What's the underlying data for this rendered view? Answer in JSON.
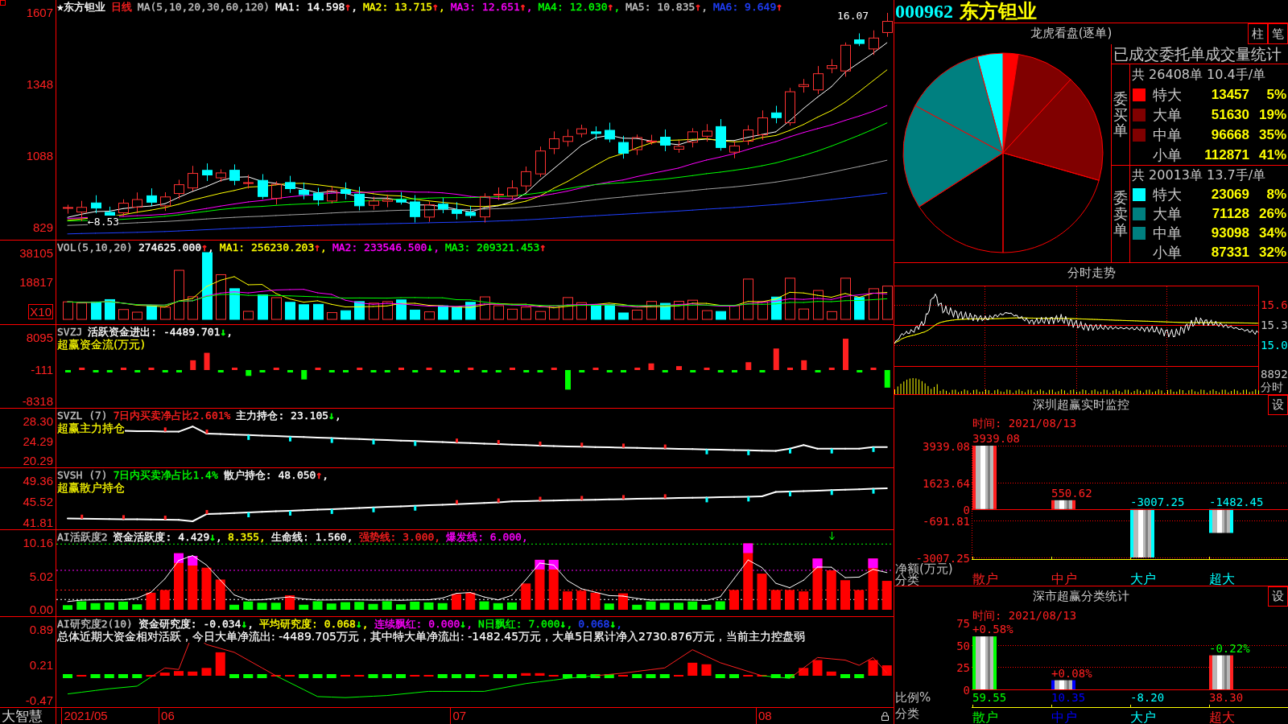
{
  "main_chart": {
    "legend": [
      {
        "text": "★东方钽业",
        "color": "#ffffff"
      },
      {
        "text": "日线",
        "color": "#ff2020"
      },
      {
        "text": "MA(5,10,20,30,60,120)"
      },
      {
        "text": "MA1: 14.598",
        "color": "#ffffff",
        "arrow": {
          "text": "↑",
          "color": "#ff2020"
        },
        "end": ","
      },
      {
        "text": "MA2: 13.715",
        "color": "#ffff00",
        "arrow": {
          "text": "↑",
          "color": "#ff2020"
        },
        "end": ","
      },
      {
        "text": "MA3: 12.651",
        "color": "#ff00ff",
        "arrow": {
          "text": "↑",
          "color": "#ff2020"
        },
        "end": ","
      },
      {
        "text": "MA4: 12.030",
        "color": "#00ff00",
        "arrow": {
          "text": "↑",
          "color": "#ff2020"
        },
        "end": ","
      },
      {
        "text": "MA5: 10.835",
        "color": "#c0c0c0",
        "arrow": {
          "text": "↑",
          "color": "#ff2020"
        },
        "end": ","
      },
      {
        "text": "MA6: 9.649",
        "color": "#2040ff",
        "arrow": {
          "text": "↑",
          "color": "#ff2020"
        }
      }
    ],
    "y_ticks": [
      "1607",
      "1348",
      "1088",
      "829"
    ],
    "high_label": "16.07",
    "low_label": "←8.53"
  },
  "panels": [
    {
      "kind": "volume",
      "legend": [
        {
          "text": "VOL(5,10,20)"
        },
        {
          "text": "274625.000",
          "color": "#ffffff",
          "arrow": {
            "text": "↑",
            "color": "#ff2020"
          },
          "end": ","
        },
        {
          "text": "MA1: 256230.203",
          "color": "#ffff00",
          "arrow": {
            "text": "↑",
            "color": "#ff2020"
          },
          "end": ","
        },
        {
          "text": "MA2: 233546.500",
          "color": "#ff00ff",
          "arrow": {
            "text": "↓",
            "color": "#00ff00"
          },
          "end": ","
        },
        {
          "text": "MA3: 209321.453",
          "color": "#00ff00",
          "arrow": {
            "text": "↑",
            "color": "#ff2020"
          }
        }
      ],
      "y_ticks": [
        "38105",
        "18817"
      ],
      "unit": "X10"
    },
    {
      "kind": "flow",
      "legend": [
        {
          "text": "SVZJ"
        },
        {
          "text": "活跃资金进出: -4489.701",
          "color": "#ffffff",
          "arrow": {
            "text": "↓",
            "color": "#00ff00"
          },
          "end": ","
        }
      ],
      "subtitle": {
        "text": "超赢资金流(万元)",
        "color": "#ffff00"
      },
      "y_ticks": [
        "8095",
        "-111",
        "-8318"
      ]
    },
    {
      "kind": "decline",
      "legend": [
        {
          "text": "SVZL (7)"
        },
        {
          "text": "7日内买卖净占比2.601%",
          "color": "#ff2020"
        },
        {
          "text": "主力持仓: 23.105",
          "color": "#ffffff",
          "arrow": {
            "text": "↓",
            "color": "#00ff00"
          },
          "end": ","
        }
      ],
      "subtitle": {
        "text": "超赢主力持仓",
        "color": "#ffff00"
      },
      "y_ticks": [
        "28.30",
        "24.29",
        "20.29"
      ]
    },
    {
      "kind": "rise",
      "legend": [
        {
          "text": "SVSH (7)"
        },
        {
          "text": "7日内买卖净占比1.4%",
          "color": "#00ff00"
        },
        {
          "text": "散户持仓: 48.050",
          "color": "#ffffff",
          "arrow": {
            "text": "↑",
            "color": "#ff2020"
          },
          "end": ","
        }
      ],
      "subtitle": {
        "text": "超赢散户持仓",
        "color": "#ffff00"
      },
      "y_ticks": [
        "49.36",
        "45.52",
        "41.81"
      ]
    },
    {
      "kind": "activity",
      "legend": [
        {
          "text": "AI活跃度2"
        },
        {
          "text": "资金活跃度: 4.429",
          "color": "#ffffff",
          "arrow": {
            "text": "↓",
            "color": "#00ff00"
          },
          "end": ","
        },
        {
          "text": "8.355,",
          "color": "#ffff00"
        },
        {
          "text": "生命线: 1.560,",
          "color": "#ffffff"
        },
        {
          "text": "强势线: 3.000,",
          "color": "#ff2020"
        },
        {
          "text": "爆发线: 6.000,",
          "color": "#ff00ff"
        }
      ],
      "y_ticks": [
        "10.16",
        "5.02",
        "0.00"
      ]
    },
    {
      "kind": "research",
      "legend": [
        {
          "text": "AI研究度2(10)"
        },
        {
          "text": "资金研究度: -0.034",
          "color": "#ffffff",
          "arrow": {
            "text": "↓",
            "color": "#00ff00"
          },
          "end": ","
        },
        {
          "text": "平均研究度: 0.068",
          "color": "#ffff00",
          "arrow": {
            "text": "↓",
            "color": "#00ff00"
          },
          "end": ","
        },
        {
          "text": "连续飘红: 0.000",
          "color": "#ff00ff",
          "arrow": {
            "text": "↓",
            "color": "#00ff00"
          },
          "end": ","
        },
        {
          "text": "N日飘红: 7.000",
          "color": "#00ff00",
          "arrow": {
            "text": "↓",
            "color": "#00ff00"
          },
          "end": ","
        },
        {
          "text": "0.068",
          "color": "#2040ff",
          "arrow": {
            "text": "↓",
            "color": "#00ff00"
          },
          "end": ","
        }
      ],
      "subtitle": {
        "text": "总体近期大资金相对活跃，今日大单净流出: -4489.705万元，其中特大单净流出: -1482.45万元，大单5日累计净入2730.876万元，当前主力控盘弱",
        "color": "#ffffff"
      },
      "y_ticks": [
        "0.89",
        "0.21",
        "-0.47"
      ]
    }
  ],
  "date_axis": {
    "brand": "大智慧",
    "dates": [
      "2021/05",
      "06",
      "07",
      "08"
    ]
  },
  "stock": {
    "code": "000962",
    "name": "东方钽业"
  },
  "order_flow": {
    "title": "龙虎看盘(逐单)",
    "view_buttons": [
      "柱",
      "笔"
    ],
    "table_title": "已成交委托单成交量统计",
    "groups": [
      {
        "side_label": "委买单",
        "summary": "共 26408单 10.4手/单",
        "rows": [
          {
            "name": "特大",
            "count": "13457",
            "share": "5%",
            "color": "#ff0000"
          },
          {
            "name": "大单",
            "count": "51630",
            "share": "19%",
            "color": "#800000"
          },
          {
            "name": "中单",
            "count": "96668",
            "share": "35%",
            "color": "#800000"
          },
          {
            "name": "小单",
            "count": "112871",
            "share": "41%"
          }
        ]
      },
      {
        "side_label": "委卖单",
        "summary": "共 20013单 13.7手/单",
        "rows": [
          {
            "name": "特大",
            "count": "23069",
            "share": "8%",
            "color": "#00ffff"
          },
          {
            "name": "大单",
            "count": "71128",
            "share": "26%",
            "color": "#008080"
          },
          {
            "name": "中单",
            "count": "93098",
            "share": "34%",
            "color": "#008080"
          },
          {
            "name": "小单",
            "count": "87331",
            "share": "32%"
          }
        ]
      }
    ]
  },
  "intraday": {
    "title": "分时走势",
    "price_ticks": [
      {
        "label": "15.6",
        "color": "#ff2020"
      },
      {
        "label": "15.3",
        "color": "#c0c0c0"
      },
      {
        "label": "15.0",
        "color": "#00ffff"
      }
    ],
    "volume_tick": "8892",
    "volume_label": "分时"
  },
  "net_monitor": {
    "title": "深圳超赢实时监控",
    "settings_button": "设",
    "time": "时间: 2021/08/13",
    "y_label": "净额(万元)",
    "x_label": "分类",
    "bars": [
      {
        "color": "#ff2020"
      },
      {
        "color": "#ff2020"
      },
      {
        "color": "#00ffff"
      },
      {
        "color": "#00ffff"
      }
    ],
    "chart_data": {
      "type": "bar",
      "categories": [
        "散户",
        "中户",
        "大户",
        "超大"
      ],
      "values": [
        3939.08,
        550.62,
        -3007.25,
        -1482.45
      ],
      "ylim": [
        -3007.25,
        3939.08
      ],
      "yticks": [
        {
          "value": 3939.08,
          "label": "3939.08"
        },
        {
          "value": 1623.64,
          "label": "1623.64"
        },
        {
          "value": 0,
          "label": "0"
        },
        {
          "value": -691.81,
          "label": "-691.81"
        },
        {
          "value": -3007.25,
          "label": "-3007.25"
        }
      ],
      "value_labels": [
        "3939.08",
        "550.62",
        "-3007.25",
        "-1482.45"
      ]
    }
  },
  "class_stats": {
    "title": "深市超赢分类统计",
    "settings_button": "设",
    "time": "时间: 2021/08/13",
    "y_label": "比例%",
    "x_label": "分类",
    "bars": [
      {
        "color": "#00ff00",
        "change": {
          "text": "+0.58%",
          "color": "#ff2020"
        }
      },
      {
        "color": "#0000ff",
        "change": {
          "text": "+0.08%",
          "color": "#ff2020"
        }
      },
      {
        "color": "#00ffff"
      },
      {
        "color": "#ff2020",
        "change": {
          "text": "-0.22%",
          "color": "#00ff00"
        }
      }
    ],
    "chart_data": {
      "type": "bar",
      "categories": [
        "散户",
        "中户",
        "大户",
        "超大"
      ],
      "values": [
        59.55,
        10.35,
        null,
        38.3
      ],
      "ylim": [
        0,
        75
      ],
      "yticks": [
        0,
        25,
        50,
        75
      ],
      "value_labels": [
        "59.55",
        "10.35",
        "-8.20",
        "38.30"
      ]
    }
  }
}
